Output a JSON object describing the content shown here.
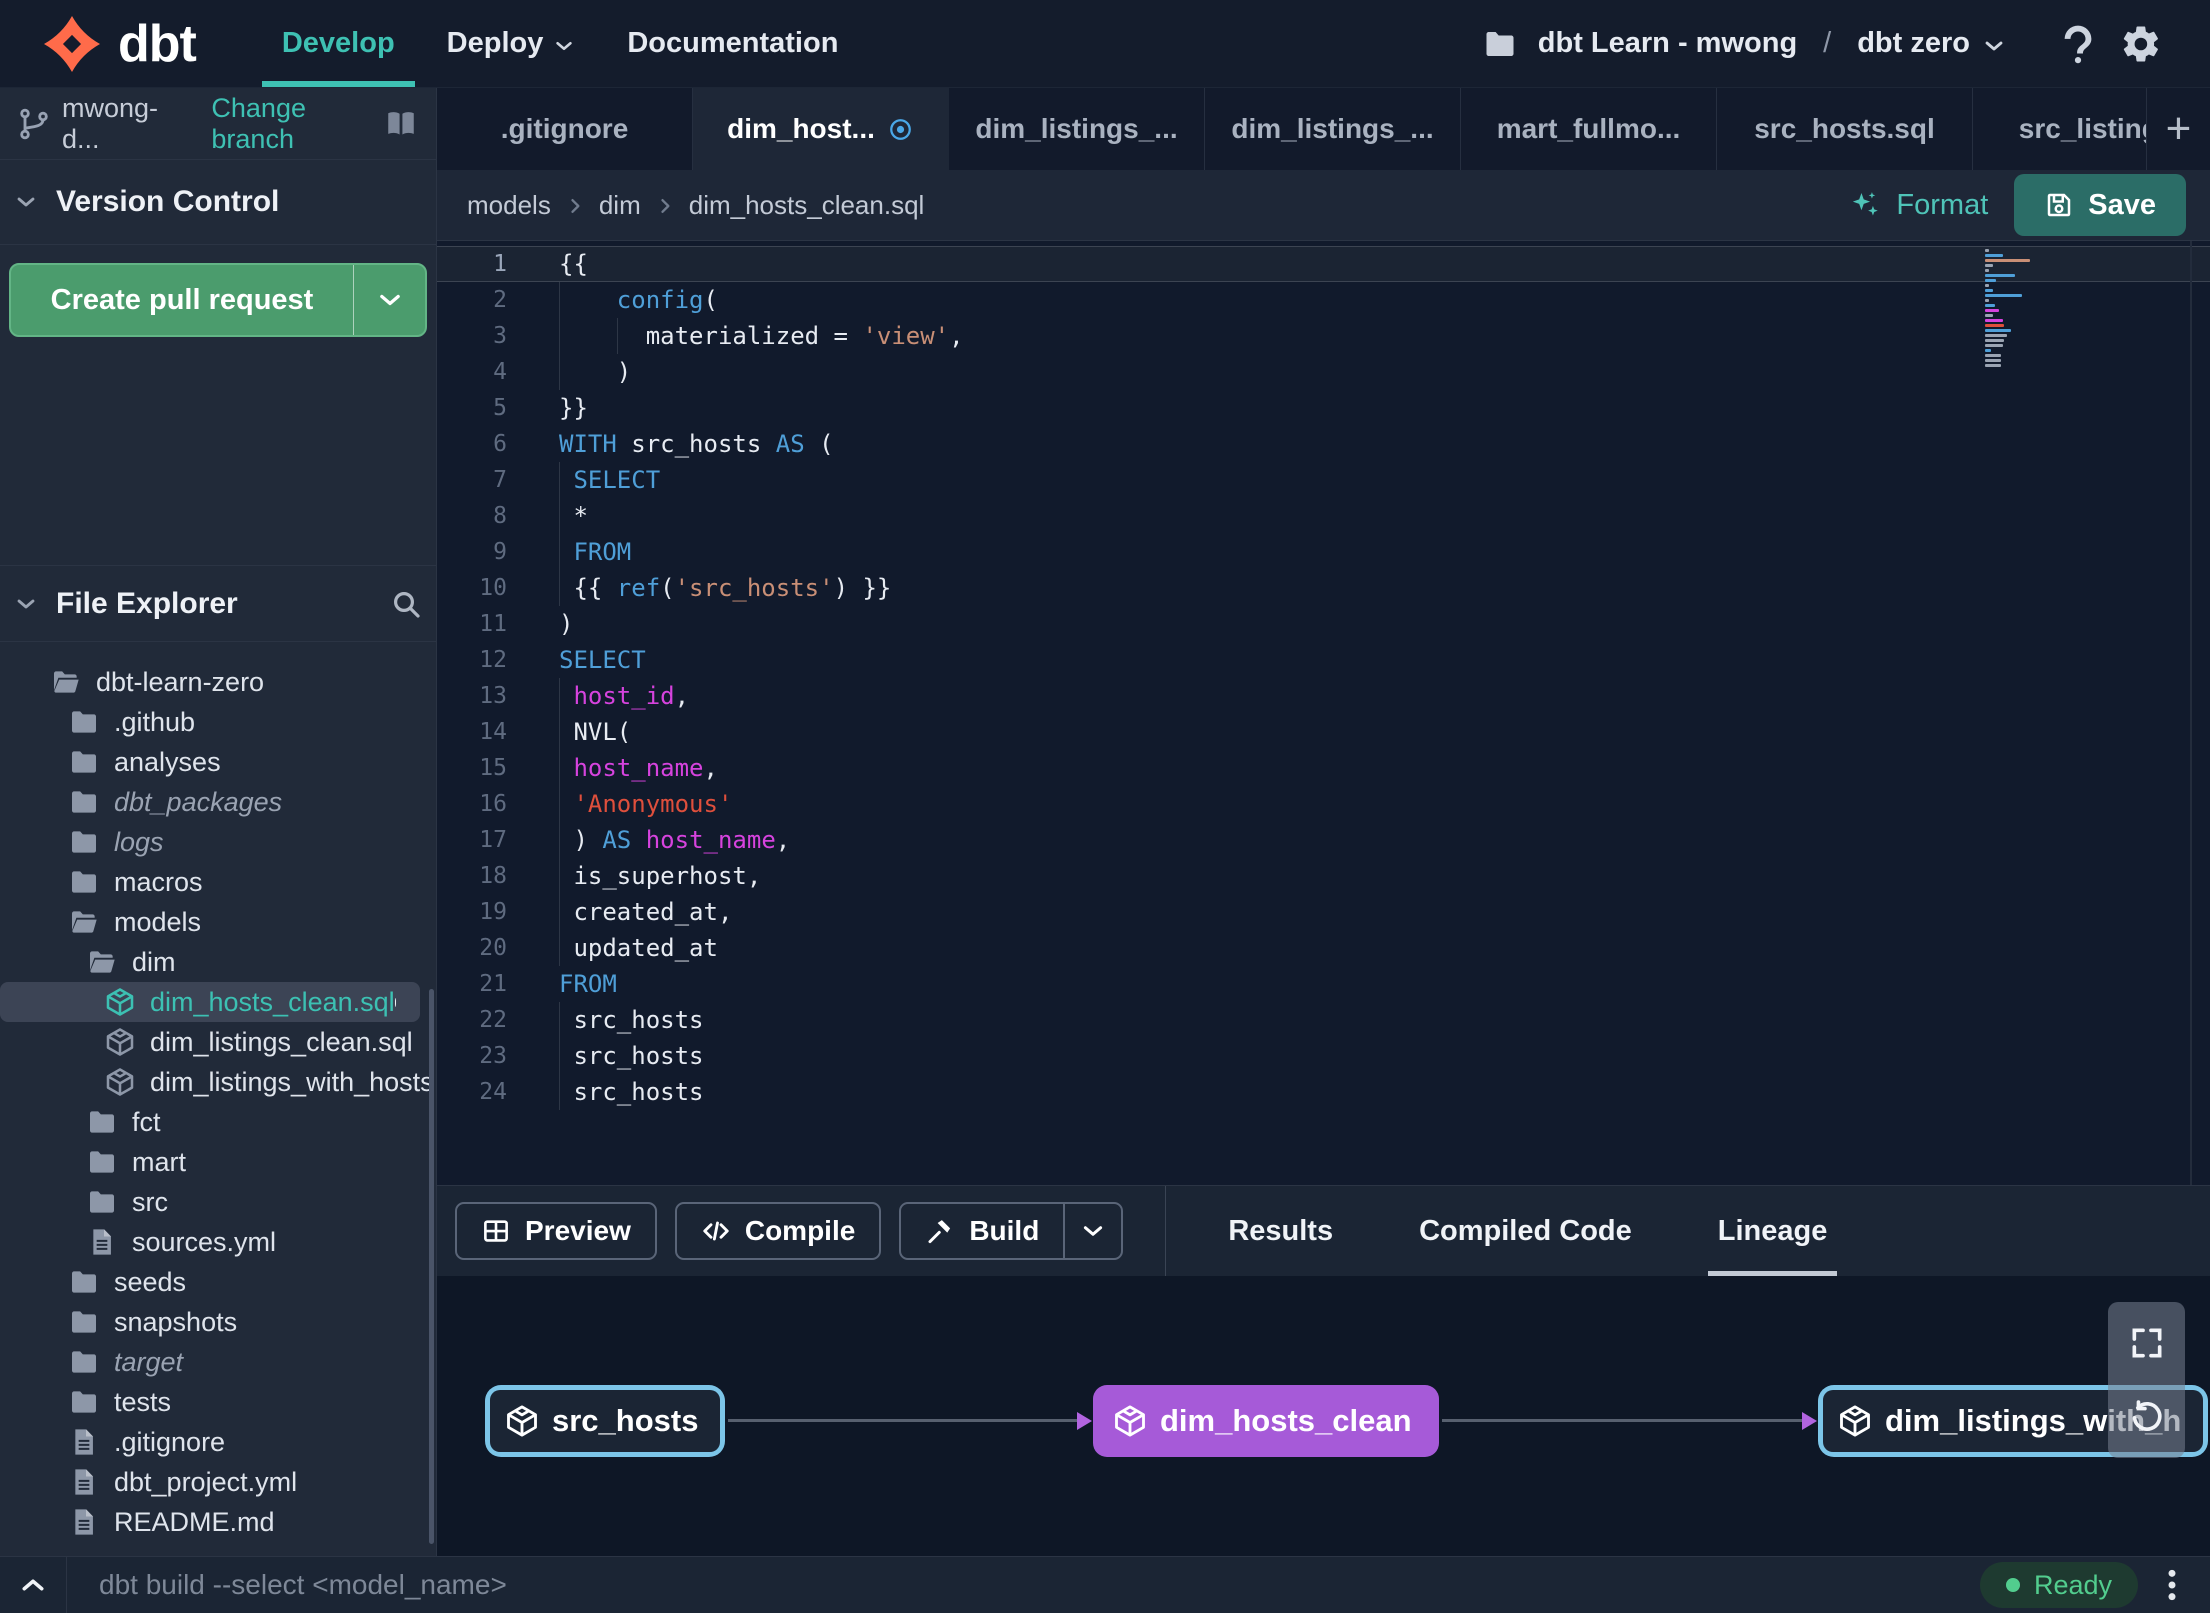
{
  "navbar": {
    "logo_text": "dbt",
    "nav_items": [
      {
        "label": "Develop",
        "active": true
      },
      {
        "label": "Deploy",
        "has_chevron": true
      },
      {
        "label": "Documentation"
      }
    ],
    "project_breadcrumb": {
      "account": "dbt Learn - mwong",
      "separator": "/",
      "project": "dbt zero"
    }
  },
  "sidebar": {
    "branch_name": "mwong-d...",
    "change_branch_label": "Change branch",
    "version_control_title": "Version Control",
    "create_pr_label": "Create pull request",
    "file_explorer_title": "File Explorer",
    "tree": [
      {
        "label": "dbt-learn-zero",
        "type": "folder-open",
        "depth": 0
      },
      {
        "label": ".github",
        "type": "folder",
        "depth": 1
      },
      {
        "label": "analyses",
        "type": "folder",
        "depth": 1
      },
      {
        "label": "dbt_packages",
        "type": "folder",
        "depth": 1,
        "italic": true
      },
      {
        "label": "logs",
        "type": "folder",
        "depth": 1,
        "italic": true
      },
      {
        "label": "macros",
        "type": "folder",
        "depth": 1
      },
      {
        "label": "models",
        "type": "folder-open",
        "depth": 1
      },
      {
        "label": "dim",
        "type": "folder-open",
        "depth": 2
      },
      {
        "label": "dim_hosts_clean.sql",
        "type": "model",
        "depth": 3,
        "selected": true,
        "modified": true
      },
      {
        "label": "dim_listings_clean.sql",
        "type": "model",
        "depth": 3
      },
      {
        "label": "dim_listings_with_hosts...",
        "type": "model",
        "depth": 3
      },
      {
        "label": "fct",
        "type": "folder",
        "depth": 2
      },
      {
        "label": "mart",
        "type": "folder",
        "depth": 2
      },
      {
        "label": "src",
        "type": "folder",
        "depth": 2
      },
      {
        "label": "sources.yml",
        "type": "file",
        "depth": 2
      },
      {
        "label": "seeds",
        "type": "folder",
        "depth": 1
      },
      {
        "label": "snapshots",
        "type": "folder",
        "depth": 1
      },
      {
        "label": "target",
        "type": "folder",
        "depth": 1,
        "italic": true
      },
      {
        "label": "tests",
        "type": "folder",
        "depth": 1
      },
      {
        "label": ".gitignore",
        "type": "file",
        "depth": 1
      },
      {
        "label": "dbt_project.yml",
        "type": "file",
        "depth": 1
      },
      {
        "label": "README.md",
        "type": "file",
        "depth": 1
      }
    ]
  },
  "editor": {
    "tabs": [
      {
        "label": ".gitignore"
      },
      {
        "label": "dim_host...",
        "active": true,
        "modified": true
      },
      {
        "label": "dim_listings_..."
      },
      {
        "label": "dim_listings_..."
      },
      {
        "label": "mart_fullmo..."
      },
      {
        "label": "src_hosts.sql"
      },
      {
        "label": "src_listings."
      }
    ],
    "new_tab_label": "+",
    "breadcrumb": [
      "models",
      "dim",
      "dim_hosts_clean.sql"
    ],
    "format_label": "Format",
    "save_label": "Save",
    "code_lines": [
      {
        "n": 1,
        "tokens": [
          {
            "t": "{{",
            "c": "pln"
          }
        ],
        "guides": []
      },
      {
        "n": 2,
        "tokens": [
          {
            "t": "    ",
            "c": "pln"
          },
          {
            "t": "config",
            "c": "kw"
          },
          {
            "t": "(",
            "c": "pln"
          }
        ],
        "guides": [
          0
        ]
      },
      {
        "n": 3,
        "tokens": [
          {
            "t": "      materialized = ",
            "c": "pln"
          },
          {
            "t": "'view'",
            "c": "str"
          },
          {
            "t": ",",
            "c": "pln"
          }
        ],
        "guides": [
          0,
          4
        ]
      },
      {
        "n": 4,
        "tokens": [
          {
            "t": "    )",
            "c": "pln"
          }
        ],
        "guides": [
          0
        ]
      },
      {
        "n": 5,
        "tokens": [
          {
            "t": "}}",
            "c": "pln"
          }
        ],
        "guides": []
      },
      {
        "n": 6,
        "tokens": [
          {
            "t": "WITH",
            "c": "kw"
          },
          {
            "t": " src_hosts ",
            "c": "pln"
          },
          {
            "t": "AS",
            "c": "kw"
          },
          {
            "t": " (",
            "c": "pln"
          }
        ],
        "guides": []
      },
      {
        "n": 7,
        "tokens": [
          {
            "t": " ",
            "c": "pln"
          },
          {
            "t": "SELECT",
            "c": "kw"
          }
        ],
        "guides": [
          0
        ]
      },
      {
        "n": 8,
        "tokens": [
          {
            "t": " *",
            "c": "pln"
          }
        ],
        "guides": [
          0
        ]
      },
      {
        "n": 9,
        "tokens": [
          {
            "t": " ",
            "c": "pln"
          },
          {
            "t": "FROM",
            "c": "kw"
          }
        ],
        "guides": [
          0
        ]
      },
      {
        "n": 10,
        "tokens": [
          {
            "t": " {{ ",
            "c": "pln"
          },
          {
            "t": "ref",
            "c": "kw"
          },
          {
            "t": "(",
            "c": "pln"
          },
          {
            "t": "'src_hosts'",
            "c": "str"
          },
          {
            "t": ") }}",
            "c": "pln"
          }
        ],
        "guides": [
          0
        ]
      },
      {
        "n": 11,
        "tokens": [
          {
            "t": ")",
            "c": "pln"
          }
        ],
        "guides": []
      },
      {
        "n": 12,
        "tokens": [
          {
            "t": "SELECT",
            "c": "kw"
          }
        ],
        "guides": []
      },
      {
        "n": 13,
        "tokens": [
          {
            "t": " ",
            "c": "pln"
          },
          {
            "t": "host_id",
            "c": "id"
          },
          {
            "t": ",",
            "c": "pln"
          }
        ],
        "guides": [
          0
        ]
      },
      {
        "n": 14,
        "tokens": [
          {
            "t": " NVL(",
            "c": "pln"
          }
        ],
        "guides": [
          0
        ]
      },
      {
        "n": 15,
        "tokens": [
          {
            "t": " ",
            "c": "pln"
          },
          {
            "t": "host_name",
            "c": "id"
          },
          {
            "t": ",",
            "c": "pln"
          }
        ],
        "guides": [
          0
        ]
      },
      {
        "n": 16,
        "tokens": [
          {
            "t": " ",
            "c": "pln"
          },
          {
            "t": "'Anonymous'",
            "c": "red"
          }
        ],
        "guides": [
          0
        ]
      },
      {
        "n": 17,
        "tokens": [
          {
            "t": " ) ",
            "c": "pln"
          },
          {
            "t": "AS",
            "c": "kw"
          },
          {
            "t": " ",
            "c": "pln"
          },
          {
            "t": "host_name",
            "c": "id"
          },
          {
            "t": ",",
            "c": "pln"
          }
        ],
        "guides": [
          0
        ]
      },
      {
        "n": 18,
        "tokens": [
          {
            "t": " is_superhost,",
            "c": "pln"
          }
        ],
        "guides": [
          0
        ]
      },
      {
        "n": 19,
        "tokens": [
          {
            "t": " created_at,",
            "c": "pln"
          }
        ],
        "guides": [
          0
        ]
      },
      {
        "n": 20,
        "tokens": [
          {
            "t": " updated_at",
            "c": "pln"
          }
        ],
        "guides": [
          0
        ]
      },
      {
        "n": 21,
        "tokens": [
          {
            "t": "FROM",
            "c": "kw"
          }
        ],
        "guides": []
      },
      {
        "n": 22,
        "tokens": [
          {
            "t": " src_hosts",
            "c": "pln"
          }
        ],
        "guides": [
          0
        ]
      },
      {
        "n": 23,
        "tokens": [
          {
            "t": " src_hosts",
            "c": "pln"
          }
        ],
        "guides": [
          0
        ]
      },
      {
        "n": 24,
        "tokens": [
          {
            "t": " src_hosts",
            "c": "pln"
          }
        ],
        "guides": [
          0
        ]
      }
    ]
  },
  "bottom_panel": {
    "actions": [
      {
        "label": "Preview",
        "icon": "grid"
      },
      {
        "label": "Compile",
        "icon": "code"
      },
      {
        "label": "Build",
        "icon": "hammer",
        "split": true
      }
    ],
    "tabs": [
      {
        "label": "Results"
      },
      {
        "label": "Compiled Code"
      },
      {
        "label": "Lineage",
        "active": true
      }
    ],
    "lineage_nodes": [
      {
        "label": "src_hosts",
        "variant": "source"
      },
      {
        "label": "dim_hosts_clean",
        "variant": "selected"
      },
      {
        "label": "dim_listings_with_h",
        "variant": "source"
      }
    ]
  },
  "statusbar": {
    "command_placeholder": "dbt build --select <model_name>",
    "status_label": "Ready"
  },
  "colors": {
    "accent_teal": "#3ec1b3",
    "logo_orange": "#ff6b4a",
    "pr_green": "#4b9c6d",
    "save_teal": "#2b6d67",
    "ready_green": "#52cd8e",
    "node_blue": "#7cc5e8",
    "node_purple": "#a65ad8",
    "kw_blue": "#4f9fd8",
    "string_salmon": "#c98f76",
    "string_red": "#df4f3c",
    "ident_magenta": "#d643de"
  }
}
